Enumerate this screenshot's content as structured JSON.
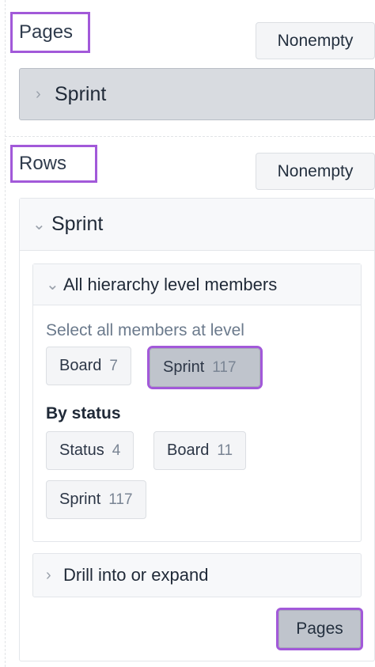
{
  "pages_section": {
    "title": "Pages",
    "nonempty_label": "Nonempty",
    "dimension": {
      "label": "Sprint",
      "chevron": "chevron-right-icon"
    }
  },
  "rows_section": {
    "title": "Rows",
    "nonempty_label": "Nonempty",
    "dimension": {
      "label": "Sprint",
      "chevron": "chevron-down-icon"
    },
    "hierarchy": {
      "title": "All hierarchy level members",
      "select_all_label": "Select all members at level",
      "levels": [
        {
          "label": "Board",
          "count": "7",
          "selected": false
        },
        {
          "label": "Sprint",
          "count": "117",
          "selected": true
        }
      ],
      "by_status_label": "By status",
      "by_status": [
        {
          "label": "Status",
          "count": "4"
        },
        {
          "label": "Board",
          "count": "11"
        },
        {
          "label": "Sprint",
          "count": "117"
        }
      ]
    },
    "drill": {
      "title": "Drill into or expand"
    },
    "pages_button": "Pages"
  },
  "colors": {
    "highlight": "#a259d9",
    "selected_chip": "#bfc4cc"
  }
}
